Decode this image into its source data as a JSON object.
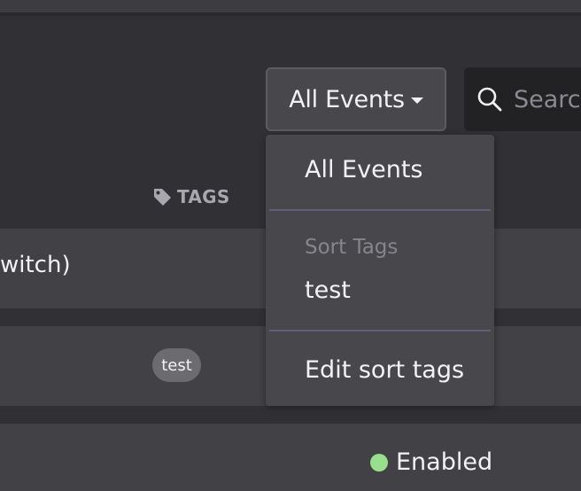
{
  "filter": {
    "label": "All Events"
  },
  "search": {
    "placeholder": "Search"
  },
  "table": {
    "tags_header": "TAGS",
    "rows": [
      {
        "name": "witch)"
      },
      {
        "tag": "test"
      },
      {
        "status": "Enabled"
      }
    ]
  },
  "dropdown": {
    "items": [
      {
        "label": "All Events"
      },
      {
        "header": "Sort Tags"
      },
      {
        "label": "test"
      },
      {
        "label": "Edit sort tags"
      }
    ]
  },
  "colors": {
    "enabled_dot": "#98e08e"
  }
}
